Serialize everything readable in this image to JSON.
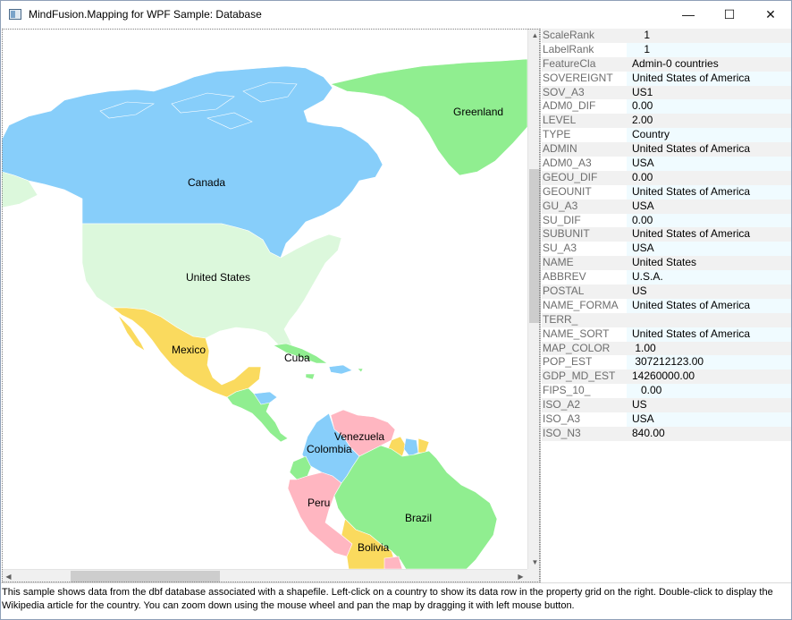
{
  "window": {
    "title": "MindFusion.Mapping for WPF Sample: Database",
    "minimize_glyph": "—",
    "maximize_glyph": "☐",
    "close_glyph": "✕"
  },
  "map": {
    "labels": {
      "greenland": "Greenland",
      "canada": "Canada",
      "united_states": "United States",
      "mexico": "Mexico",
      "cuba": "Cuba",
      "venezuela": "Venezuela",
      "colombia": "Colombia",
      "peru": "Peru",
      "brazil": "Brazil",
      "bolivia": "Bolivia"
    },
    "colors": {
      "blue": "#87cefa",
      "light_green": "#dcf8dc",
      "green": "#90ee90",
      "yellow": "#fada5e",
      "pink": "#ffb6c1"
    }
  },
  "property_grid": [
    {
      "key": "ScaleRank",
      "value": "    1"
    },
    {
      "key": "LabelRank",
      "value": "    1"
    },
    {
      "key": "FeatureCla",
      "value": "Admin-0 countries"
    },
    {
      "key": "SOVEREIGNT",
      "value": "United States of America"
    },
    {
      "key": "SOV_A3",
      "value": "US1"
    },
    {
      "key": "ADM0_DIF",
      "value": "0.00"
    },
    {
      "key": "LEVEL",
      "value": "2.00"
    },
    {
      "key": "TYPE",
      "value": "Country"
    },
    {
      "key": "ADMIN",
      "value": "United States of America"
    },
    {
      "key": "ADM0_A3",
      "value": "USA"
    },
    {
      "key": "GEOU_DIF",
      "value": "0.00"
    },
    {
      "key": "GEOUNIT",
      "value": "United States of America"
    },
    {
      "key": "GU_A3",
      "value": "USA"
    },
    {
      "key": "SU_DIF",
      "value": "0.00"
    },
    {
      "key": "SUBUNIT",
      "value": "United States of America"
    },
    {
      "key": "SU_A3",
      "value": "USA"
    },
    {
      "key": "NAME",
      "value": "United States"
    },
    {
      "key": "ABBREV",
      "value": "U.S.A."
    },
    {
      "key": "POSTAL",
      "value": "US"
    },
    {
      "key": "NAME_FORMA",
      "value": "United States of America"
    },
    {
      "key": "TERR_",
      "value": ""
    },
    {
      "key": "NAME_SORT",
      "value": "United States of America"
    },
    {
      "key": "MAP_COLOR",
      "value": " 1.00"
    },
    {
      "key": "POP_EST",
      "value": " 307212123.00"
    },
    {
      "key": "GDP_MD_EST",
      "value": "14260000.00"
    },
    {
      "key": "FIPS_10_",
      "value": "   0.00"
    },
    {
      "key": "ISO_A2",
      "value": "US"
    },
    {
      "key": "ISO_A3",
      "value": "USA"
    },
    {
      "key": "ISO_N3",
      "value": "840.00"
    }
  ],
  "status_text": "This sample shows data from the dbf database associated with a shapefile. Left-click on a country to show its data row in the property grid on the right.  Double-click to display the Wikipedia article for the country. You can zoom down using the mouse wheel and pan the map by dragging it with left mouse button."
}
